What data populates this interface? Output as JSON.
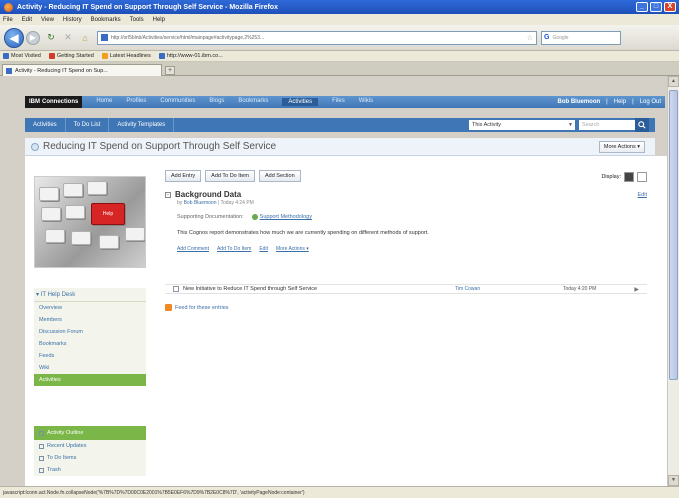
{
  "window": {
    "title": "Activity - Reducing IT Spend on Support Through Self Service - Mozilla Firefox",
    "controls": [
      "_",
      "□",
      "X"
    ]
  },
  "menubar": [
    "File",
    "Edit",
    "View",
    "History",
    "Bookmarks",
    "Tools",
    "Help"
  ],
  "navbar": {
    "url": "http://orl5blnb/Activities/service/html/mainpage#activitypage,2%253...",
    "search_placeholder": "Google",
    "google_label": "G"
  },
  "bookmarks": [
    {
      "label": "Most Visited",
      "color": "#3b6cc4"
    },
    {
      "label": "Getting Started",
      "color": "#d23b2a"
    },
    {
      "label": "Latest Headlines",
      "color": "#f0a020"
    },
    {
      "label": "http://www-01.ibm.co...",
      "color": "#3b6cc4"
    }
  ],
  "tab": {
    "label": "Activity - Reducing IT Spend on Sup...",
    "new_tab": "+"
  },
  "app": {
    "logo_ibm": "IBM",
    "logo_product": "Connections",
    "nav": [
      "Home",
      "Profiles",
      "Communities",
      "Blogs",
      "Bookmarks",
      "Activities",
      "Files",
      "Wikis"
    ],
    "active_nav": "Activities",
    "user": "Bob Bluemoon",
    "help": "Help",
    "logout": "Log Out"
  },
  "subnav": {
    "items": [
      "Activities",
      "To Do List",
      "Activity Templates"
    ],
    "scope": "This Activity",
    "search_placeholder": "Search"
  },
  "page": {
    "title": "Reducing IT Spend on Support Through Self Service",
    "more_actions": "More Actions ▾"
  },
  "sidebar": {
    "image_key_label": "Help",
    "heading": "IT Help Desk",
    "links": [
      "Overview",
      "Members",
      "Discussion Forum",
      "Bookmarks",
      "Feeds",
      "Wiki",
      "Activities"
    ],
    "active_link": "Activities",
    "views_heading": "Activity Outline",
    "views": [
      "Recent Updates",
      "To Do Items",
      "Trash"
    ]
  },
  "main": {
    "buttons": [
      "Add Entry",
      "Add To Do Item",
      "Add Section"
    ],
    "display_label": "Display:",
    "entry": {
      "toggle": "−",
      "title": "Background Data",
      "meta_prefix": "by",
      "meta_author": "Bob Bluemoon",
      "meta_sep": "| Today 4:24 PM",
      "edit": "Edit",
      "support_label": "Supporting Documentation:",
      "attachment": "Support Methodology",
      "description": "This Cognos report demonstrates how much we are currently spending on different methods of support.",
      "actions": [
        "Add Comment",
        "Add To Do Item",
        "Edit",
        "More Actions ▾"
      ]
    },
    "todo": {
      "title": "New Initiative to Reduce IT Spend through Self Service",
      "assignee": "Tim Cowan",
      "date": "Today 4:20 PM",
      "more": "▶"
    },
    "feed_label": "Feed for these entries"
  },
  "statusbar": {
    "text": "javascript:lconn.act.Node.fn.collapseNode('%7B%7D%7D00C0E2001%7B5E0EF6%7D9%7B2E0C8%7D', 'activityPageNode:container')"
  }
}
